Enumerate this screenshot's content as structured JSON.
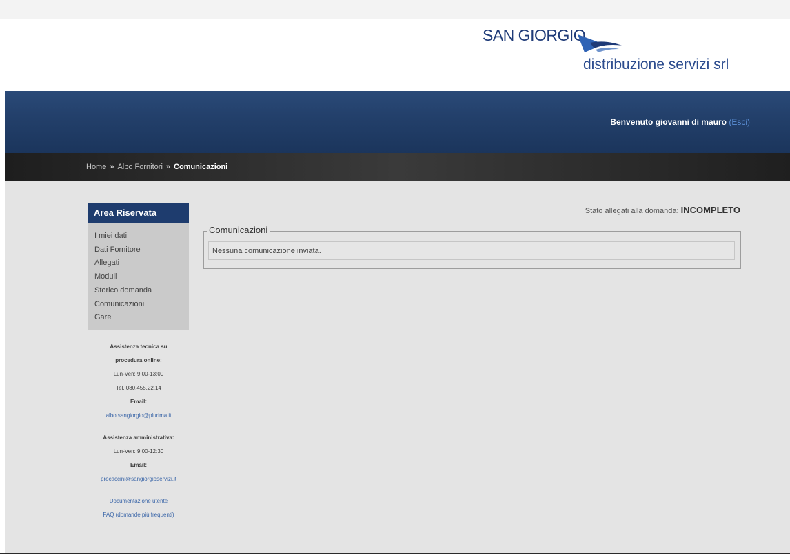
{
  "brand": {
    "name": "SAN GIORGIO",
    "subtitle": "distribuzione servizi srl"
  },
  "header": {
    "welcome": "Benvenuto giovanni di mauro",
    "logout": "(Esci)"
  },
  "breadcrumb": {
    "items": [
      "Home",
      "Albo Fornitori",
      "Comunicazioni"
    ],
    "separator": "»"
  },
  "sidebar": {
    "title": "Area Riservata",
    "items": [
      {
        "label": "I miei dati"
      },
      {
        "label": "Dati Fornitore"
      },
      {
        "label": "Allegati"
      },
      {
        "label": "Moduli"
      },
      {
        "label": "Storico domanda"
      },
      {
        "label": "Comunicazioni"
      },
      {
        "label": "Gare"
      }
    ]
  },
  "assist_tech": {
    "title_1": "Assistenza tecnica su",
    "title_2": "procedura online:",
    "hours": "Lun-Ven: 9:00-13:00",
    "tel": "Tel. 080.455.22.14",
    "email_label": "Email:",
    "email": "albo.sangiorgio@plurima.it"
  },
  "assist_admin": {
    "title": "Assistenza amministrativa:",
    "hours": "Lun-Ven: 9:00-12:30",
    "email_label": "Email:",
    "email": "procaccini@sangiorgioservizi.it"
  },
  "links": {
    "docs": "Documentazione utente",
    "faq": "FAQ (domande più frequenti)"
  },
  "main": {
    "status_label": "Stato allegati alla domanda:",
    "status_value": "INCOMPLETO",
    "section_title": "Comunicazioni",
    "empty_message": "Nessuna comunicazione inviata."
  },
  "colors": {
    "brand_blue": "#1e3c6e",
    "link_blue": "#3b66a8",
    "logout_blue": "#5b8fd6"
  }
}
